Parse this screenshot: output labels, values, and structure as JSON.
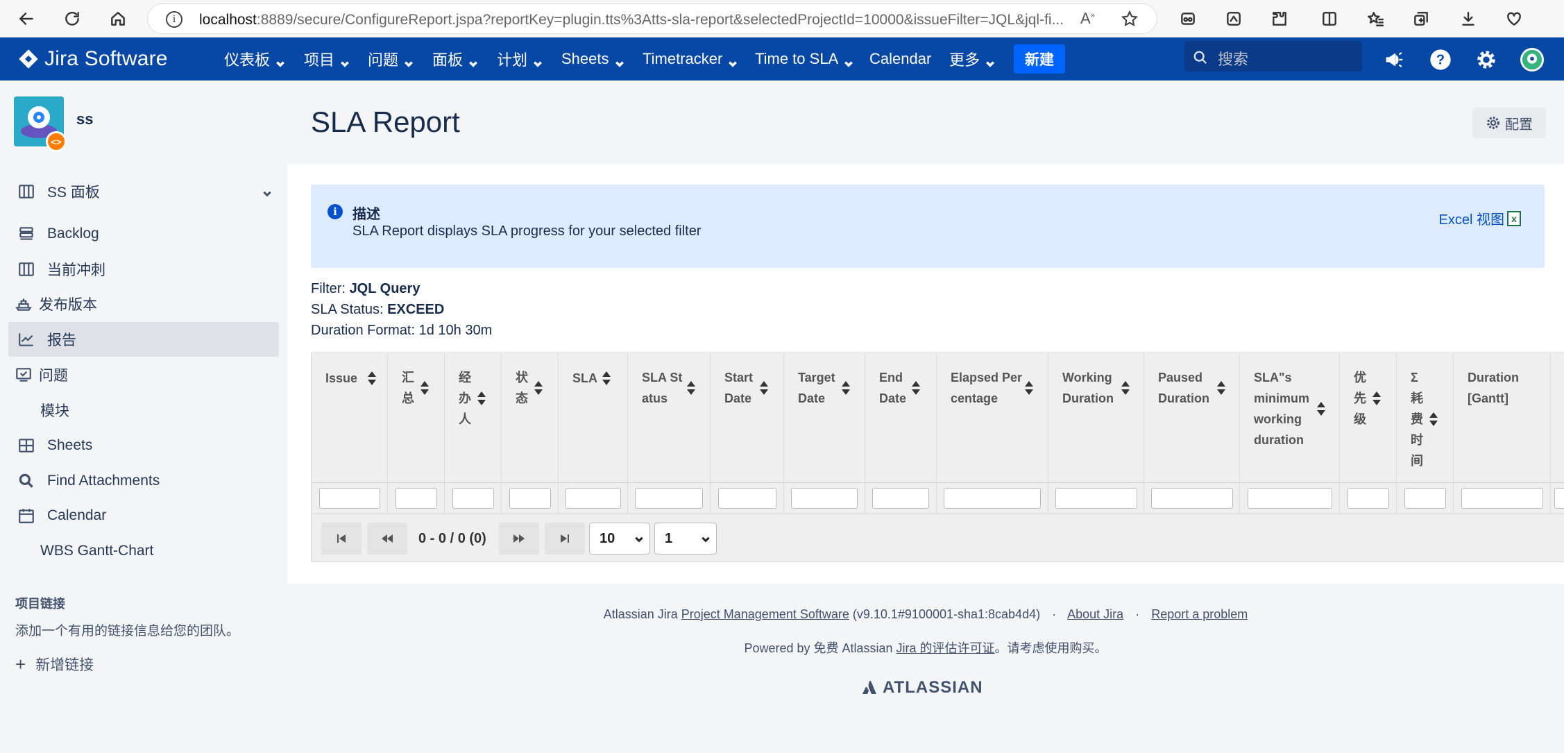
{
  "browser": {
    "url_host": "localhost",
    "url_rest": ":8889/secure/ConfigureReport.jspa?reportKey=plugin.tts%3Atts-sla-report&selectedProjectId=10000&issueFilter=JQL&jql-fi..."
  },
  "topnav": {
    "logo": "Jira Software",
    "items": [
      "仪表板",
      "项目",
      "问题",
      "面板",
      "计划",
      "Sheets",
      "Timetracker",
      "Time to SLA",
      "Calendar",
      "更多"
    ],
    "create": "新建",
    "search_placeholder": "搜索"
  },
  "sidebar": {
    "project_name": "ss",
    "board": "SS 面板",
    "items": [
      "Backlog",
      "当前冲刺",
      "发布版本",
      "报告",
      "问题",
      "模块",
      "Sheets",
      "Find Attachments",
      "Calendar",
      "WBS Gantt-Chart"
    ],
    "links_heading": "项目链接",
    "links_desc": "添加一个有用的链接信息给您的团队。",
    "add_link": "新增链接"
  },
  "page": {
    "title": "SLA Report",
    "config_btn": "配置"
  },
  "description": {
    "title": "描述",
    "text": "SLA Report displays SLA progress for your selected filter",
    "excel": "Excel 视图"
  },
  "meta": {
    "filter_label": "Filter: ",
    "filter_value": "JQL Query",
    "status_label": "SLA Status: ",
    "status_value": "EXCEED",
    "duration_label": "Duration Format: 1d 10h 30m"
  },
  "table": {
    "columns": [
      "Issue",
      "汇总",
      "经办人",
      "状态",
      "SLA",
      "SLA Status",
      "Start Date",
      "Target Date",
      "End Date",
      "Elapsed Percentage",
      "Working Duration",
      "Paused Duration",
      "SLA\"s minimum working duration",
      "优先级",
      "Σ 耗费时间",
      "Duration [Gantt]"
    ],
    "page_count": "0 - 0 / 0 (0)",
    "page_size": "10",
    "page_number": "1"
  },
  "footer": {
    "l1_prefix": "Atlassian Jira ",
    "l1_link": "Project Management Software",
    "l1_version": " (v9.10.1#9100001-sha1:8cab4d4)",
    "about": "About Jira",
    "report": "Report a problem",
    "l2_prefix": "Powered by 免费 Atlassian ",
    "l2_link": "Jira 的评估许可证",
    "l2_suffix": "。请考虑使用购买。",
    "brand": "ATLASSIAN"
  }
}
